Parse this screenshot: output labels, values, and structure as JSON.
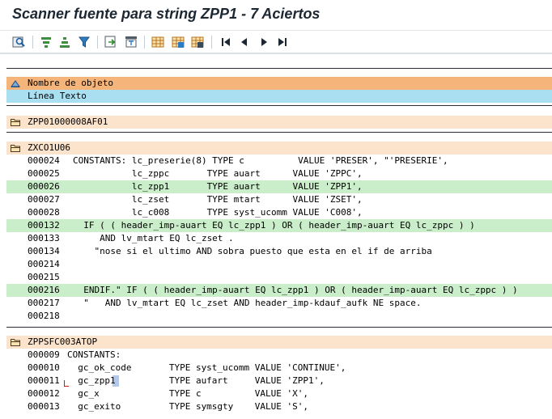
{
  "window": {
    "title": "Scanner fuente para string ZPP1 - 7 Aciertos"
  },
  "toolbar": {
    "buttons": [
      "find-icon",
      "sort-ascending-icon",
      "sort-descending-icon",
      "filter-icon",
      "export-icon",
      "print-icon",
      "layout-icon",
      "layout-select-icon",
      "layout-save-icon",
      "first-page-icon",
      "previous-page-icon",
      "next-page-icon",
      "last-page-icon"
    ]
  },
  "header": {
    "row1": "Nombre de objeto",
    "row2": "Línea Texto"
  },
  "groups": [
    {
      "name": "ZPP01000008AF01",
      "lines": []
    },
    {
      "name": "ZXCO1U06",
      "lines": [
        {
          "num": "000024",
          "text": "CONSTANTS: lc_preserie(8) TYPE c          VALUE 'PRESER', \"'PRESERIE',",
          "hit": false
        },
        {
          "num": "000025",
          "text": "           lc_zppc       TYPE auart      VALUE 'ZPPC',",
          "hit": false
        },
        {
          "num": "000026",
          "text": "           lc_zpp1       TYPE auart      VALUE 'ZPP1',",
          "hit": true
        },
        {
          "num": "000027",
          "text": "           lc_zset       TYPE mtart      VALUE 'ZSET',",
          "hit": false
        },
        {
          "num": "000028",
          "text": "           lc_c008       TYPE syst_ucomm VALUE 'C008',",
          "hit": false
        },
        {
          "num": "000132",
          "text": "  IF ( ( header_imp-auart EQ lc_zpp1 ) OR ( header_imp-auart EQ lc_zppc ) )",
          "hit": true
        },
        {
          "num": "000133",
          "text": "     AND lv_mtart EQ lc_zset .",
          "hit": false
        },
        {
          "num": "000134",
          "text": "    \"nose si el ultimo AND sobra puesto que esta en el if de arriba",
          "hit": false
        },
        {
          "num": "000214",
          "text": "",
          "hit": false
        },
        {
          "num": "000215",
          "text": "",
          "hit": false
        },
        {
          "num": "000216",
          "text": "  ENDIF.\" IF ( ( header_imp-auart EQ lc_zpp1 ) OR ( header_imp-auart EQ lc_zppc ) )",
          "hit": true
        },
        {
          "num": "000217",
          "text": "  \"   AND lv_mtart EQ lc_zset AND header_imp-kdauf_aufk NE space.",
          "hit": false
        },
        {
          "num": "000218",
          "text": "",
          "hit": false
        }
      ]
    },
    {
      "name": "ZPPSFC003ATOP",
      "lines": [
        {
          "num": "000009",
          "text": "CONSTANTS:",
          "hit": false
        },
        {
          "num": "000010",
          "text": "  gc_ok_code       TYPE syst_ucomm VALUE 'CONTINUE',",
          "hit": false
        },
        {
          "num": "000011",
          "text": "  gc_zpp1          TYPE aufart     VALUE 'ZPP1',",
          "hit": true
        },
        {
          "num": "000012",
          "text": "  gc_x             TYPE c          VALUE 'X',",
          "hit": false
        },
        {
          "num": "000013",
          "text": "  gc_exito         TYPE symsgty    VALUE 'S',",
          "hit": false
        }
      ]
    }
  ],
  "colors": {
    "hit_row": "#c9eec9",
    "header_orange": "#f5b57a",
    "header_cyan": "#a9dff1",
    "group_row": "#fbe3cc",
    "cursor_highlight": "#b5c8e8"
  }
}
